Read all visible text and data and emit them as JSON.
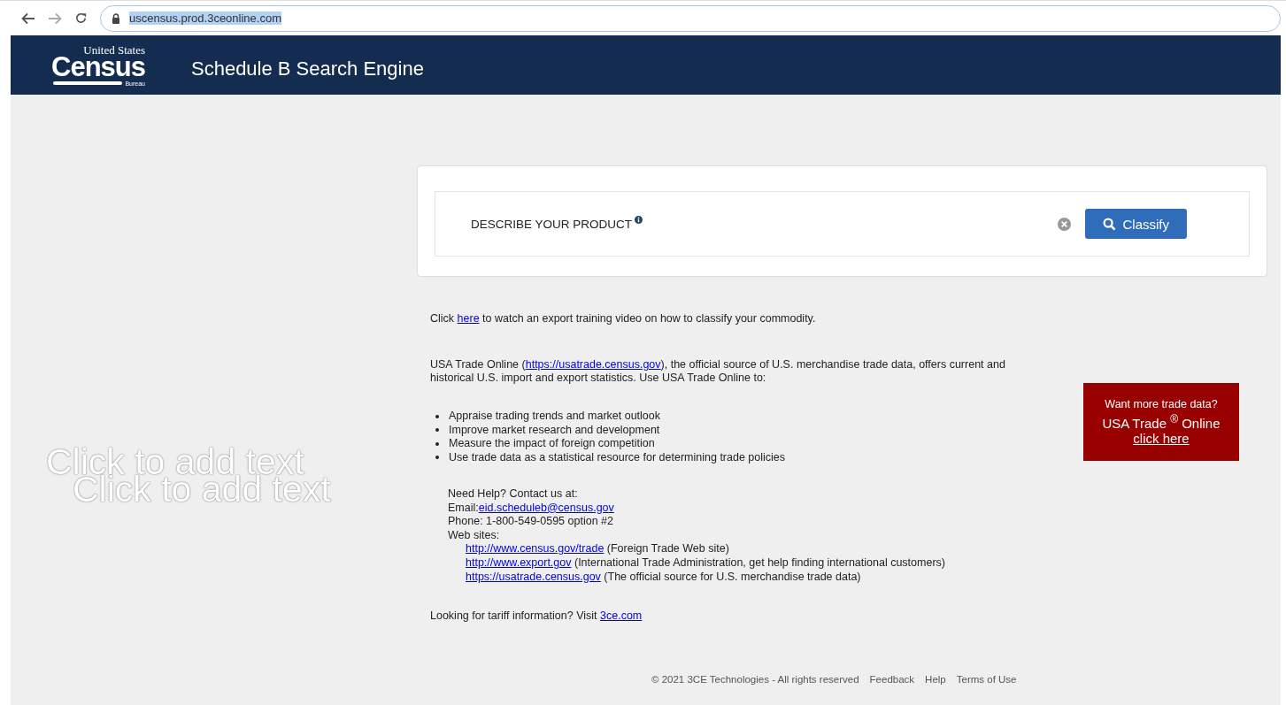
{
  "browser": {
    "url": "uscensus.prod.3ceonline.com"
  },
  "header": {
    "logo_top": "United States",
    "logo_main": "Census",
    "logo_bottom": "Bureau",
    "title": "Schedule B Search Engine"
  },
  "overlay_texts": [
    "Click to add text",
    "Click to add text"
  ],
  "search": {
    "label": "DESCRIBE YOUR PRODUCT",
    "button": "Classify"
  },
  "intro": {
    "before": "Click ",
    "link": "here",
    "after": " to watch an export training video on how to classify your commodity."
  },
  "usatrade": {
    "before": "USA Trade Online (",
    "link": "https://usatrade.census.gov",
    "after": "), the official source of U.S. merchandise trade data, offers current and historical U.S. import and export statistics. Use USA Trade Online to:"
  },
  "bullets": [
    "Appraise trading trends and market outlook",
    "Improve market research and development",
    "Measure the impact of foreign competition",
    "Use trade data as a statistical resource for determining trade policies"
  ],
  "contact": {
    "heading": "Need Help? Contact us at:",
    "email_label": "Email:",
    "email": "eid.scheduleb@census.gov",
    "phone": "Phone: 1-800-549-0595 option #2",
    "sites_label": "Web sites:",
    "sites": [
      {
        "link": "http://www.census.gov/trade",
        "note": " (Foreign Trade Web site)"
      },
      {
        "link": "http://www.export.gov",
        "note": " (International Trade Administration, get help finding international customers)"
      },
      {
        "link": "https://usatrade.census.gov",
        "note": " (The official source for U.S. merchandise trade data)"
      }
    ]
  },
  "tariff": {
    "before": "Looking for tariff information? Visit ",
    "link": "3ce.com"
  },
  "promo": {
    "line1": "Want more trade data?",
    "line2": "USA Trade $^{®}$ Online",
    "link": "click here"
  },
  "footer": {
    "copyright": "© 2021 3CE Technologies - All rights reserved",
    "links": [
      "Feedback",
      "Help",
      "Terms of Use"
    ]
  }
}
